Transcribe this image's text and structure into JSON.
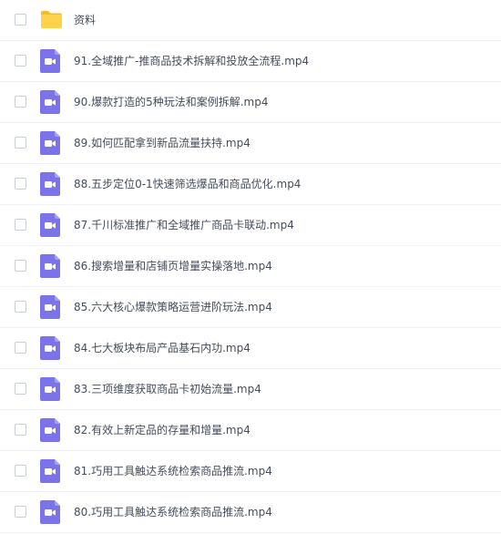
{
  "file_list": {
    "items": [
      {
        "name": "资料",
        "type": "folder",
        "icon": "folder-icon"
      },
      {
        "name": "91.全域推广-推商品技术拆解和投放全流程.mp4",
        "type": "video",
        "icon": "video-file-icon"
      },
      {
        "name": "90.爆款打造的5种玩法和案例拆解.mp4",
        "type": "video",
        "icon": "video-file-icon"
      },
      {
        "name": "89.如何匹配拿到新品流量扶持.mp4",
        "type": "video",
        "icon": "video-file-icon"
      },
      {
        "name": "88.五步定位0-1快速筛选爆品和商品优化.mp4",
        "type": "video",
        "icon": "video-file-icon"
      },
      {
        "name": "87.千川标准推广和全域推广商品卡联动.mp4",
        "type": "video",
        "icon": "video-file-icon"
      },
      {
        "name": "86.搜索增量和店铺页增量实操落地.mp4",
        "type": "video",
        "icon": "video-file-icon"
      },
      {
        "name": "85.六大核心爆款策略运营进阶玩法.mp4",
        "type": "video",
        "icon": "video-file-icon"
      },
      {
        "name": "84.七大板块布局产品基石内功.mp4",
        "type": "video",
        "icon": "video-file-icon"
      },
      {
        "name": "83.三项维度获取商品卡初始流量.mp4",
        "type": "video",
        "icon": "video-file-icon"
      },
      {
        "name": "82.有效上新定品的存量和增量.mp4",
        "type": "video",
        "icon": "video-file-icon"
      },
      {
        "name": "81.巧用工具触达系统检索商品推流.mp4",
        "type": "video",
        "icon": "video-file-icon"
      },
      {
        "name": "80.巧用工具触达系统检索商品推流.mp4",
        "type": "video",
        "icon": "video-file-icon"
      }
    ]
  },
  "colors": {
    "folder": "#ffd24c",
    "folder_tab": "#f4bc2d",
    "video": "#7a73ea",
    "text": "#454d5a",
    "checkbox_border": "#c9cdd4"
  }
}
